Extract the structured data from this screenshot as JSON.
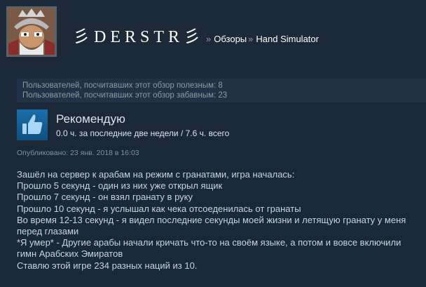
{
  "profile": {
    "persona_name": "彡DERSTR彡"
  },
  "breadcrumb": {
    "separator": "»",
    "reviews": "Обзоры",
    "game": "Hand Simulator"
  },
  "votes": {
    "helpful": "Пользователей, посчитавших этот обзор полезным: 8",
    "funny": "Пользователей, посчитавших этот обзор забавным: 23"
  },
  "review": {
    "recommendation": "Рекомендую",
    "hours": "0.0 ч. за последние две недели / 7.6 ч. всего",
    "posted": "Опубликовано: 23 янв. 2018 в 16:03",
    "lines": [
      "Зашёл на сервер к арабам на режим с гранатами, игра началась:",
      "Прошло 5 секунд - один из них уже открыл ящик",
      "Прошло 7 секунд - он взял гранату в руку",
      "Прошло 10 секунд - я услышал как чека отсоеденилась от гранаты",
      "Во время 12-13 секунд - я видел последние секунды моей жизни и летящую гранату у меня",
      "перед глазами",
      "*Я умер* - Другие арабы начали кричать что-то на своём языке, а потом и вовсе включили",
      "гимн Арабских Эмиратов",
      "Ставлю этой игре 234 разных наций из 10."
    ]
  },
  "icons": {
    "avatar": "avatar-image",
    "thumb": "thumbs-up-icon"
  },
  "colors": {
    "background": "#1b2838",
    "thumb_blue": "#1b6ea8",
    "muted_text": "#8f98a0"
  }
}
